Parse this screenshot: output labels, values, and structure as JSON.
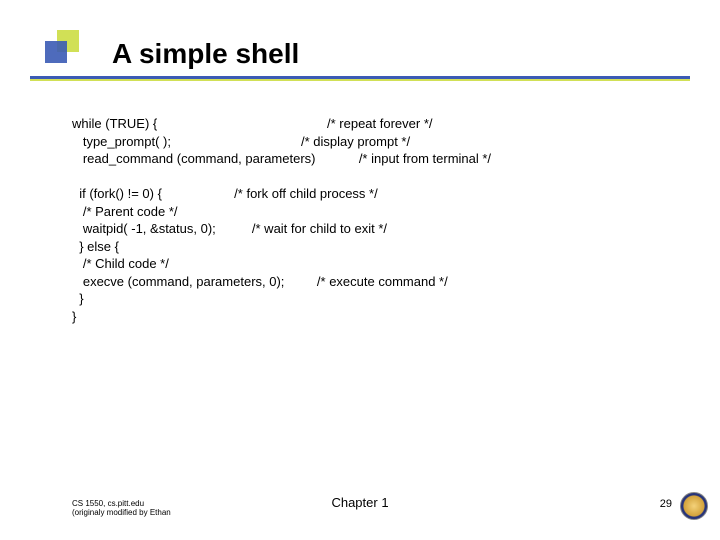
{
  "title": "A simple shell",
  "code": "while (TRUE) {                                               /* repeat forever */\n   type_prompt( );                                    /* display prompt */\n   read_command (command, parameters)            /* input from terminal */\n\n  if (fork() != 0) {                    /* fork off child process */\n   /* Parent code */\n   waitpid( -1, &status, 0);          /* wait for child to exit */\n  } else {\n   /* Child code */\n   execve (command, parameters, 0);         /* execute command */\n  }\n}",
  "footer": {
    "left_line1": "CS 1550, cs.pitt.edu",
    "left_line2": "(originaly modified by Ethan",
    "center": "Chapter 1",
    "page": "29"
  }
}
